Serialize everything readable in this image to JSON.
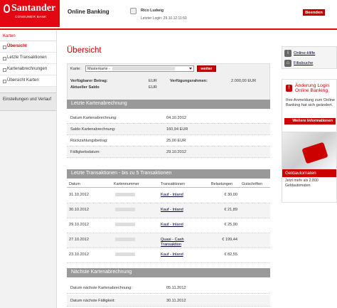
{
  "header": {
    "brand": "Santander",
    "brand_sub": "CONSUMER BANK",
    "app_title": "Online Banking",
    "user_name": "Rico Ludwig",
    "last_login": "Letzter Login: 29.10.12 11:50",
    "logout_label": "Beenden"
  },
  "sidebar": {
    "heading": "Karten",
    "items": [
      {
        "label": "Übersicht",
        "active": true
      },
      {
        "label": "Letzte Transaktionen"
      },
      {
        "label": "Kartenabrechnungen"
      },
      {
        "label": "Übersicht Karten"
      }
    ],
    "section": "Einstellungen und Verlauf"
  },
  "main": {
    "title": "Übersicht",
    "card_select": {
      "label": "Karte:",
      "value": "Masterkarte -",
      "button": "weiter"
    },
    "balance": {
      "avail_label": "Verfügbarer Betrag:",
      "avail_value": "EUR",
      "cur_label": "Aktueller Saldo",
      "cur_value": "EUR",
      "limit_label": "Verfügungsrahmen:",
      "limit_value": "2.000,00 EUR"
    },
    "last_statement": {
      "heading": "Letzte Kartenabrechnung",
      "rows": [
        {
          "k": "Datum Kartenabrechnung:",
          "v": "04.10.2012"
        },
        {
          "k": "Saldo Kartenabrechnung:",
          "v": "160,94 EUR"
        },
        {
          "k": "Rückzahlungsbetrag:",
          "v": "25,00 EUR"
        },
        {
          "k": "Fälligkeitsdatum:",
          "v": "29.10.2012"
        }
      ]
    },
    "transactions": {
      "heading": "Letzte Transaktionen - bis zu 5 Transaktionen",
      "cols": {
        "date": "Datum",
        "card": "Kartennummer",
        "tx": "Transaktionen",
        "debit": "Belastungen",
        "credit": "Gutschriften"
      },
      "rows": [
        {
          "date": "31.10.2012",
          "tx": "Kauf - Inland",
          "debit": "€ 30,00"
        },
        {
          "date": "30.10.2012",
          "tx": "Kauf - Inland",
          "debit": "€ 21,89"
        },
        {
          "date": "29.10.2012",
          "tx": "Kauf - Inland",
          "debit": "€ 25,90"
        },
        {
          "date": "27.10.2012",
          "tx": "Quasi - Cash Transaktion",
          "debit": "€ 199,44"
        },
        {
          "date": "23.10.2012",
          "tx": "Kauf - Inland",
          "debit": "€ 82,55"
        }
      ]
    },
    "next_statement": {
      "heading": "Nächste Kartenabrechnung",
      "rows": [
        {
          "k": "Datum nächste Kartenabrechnung:",
          "v": "05.11.2012"
        },
        {
          "k": "Datum nächste Fälligkeit:",
          "v": "30.11.2012"
        }
      ]
    }
  },
  "right": {
    "help_label": "Online-Hilfe",
    "branch_label": "Filialsuche",
    "login_change": {
      "title": "Änderung Login Online Banking",
      "text": "Ihre Anmeldung zum Online Banking hat sich geändert.",
      "more": "Weitere Informationen"
    },
    "atm": {
      "band": "Geldautomaten",
      "text": "Jetzt mehr als 2.800 Geldautomaten"
    }
  }
}
